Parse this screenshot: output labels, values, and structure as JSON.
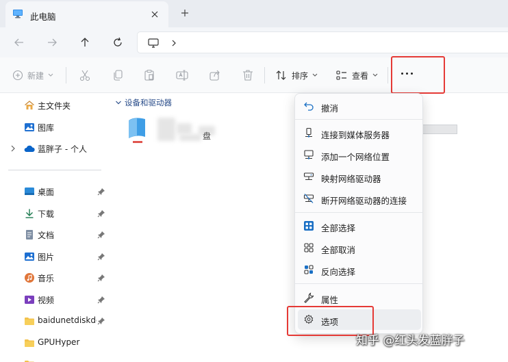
{
  "window": {
    "tab_title": "此电脑"
  },
  "toolbar": {
    "new_label": "新建",
    "sort_label": "排序",
    "view_label": "查看"
  },
  "sidebar": {
    "items": [
      {
        "label": "主文件夹",
        "icon": "home-icon"
      },
      {
        "label": "图库",
        "icon": "gallery-icon"
      },
      {
        "label": "蓝胖子 - 个人",
        "icon": "cloud-icon"
      },
      {
        "label": "桌面",
        "icon": "desktop-icon",
        "pinned": true
      },
      {
        "label": "下载",
        "icon": "download-icon",
        "pinned": true
      },
      {
        "label": "文档",
        "icon": "document-icon",
        "pinned": true
      },
      {
        "label": "图片",
        "icon": "picture-icon",
        "pinned": true
      },
      {
        "label": "音乐",
        "icon": "music-icon",
        "pinned": true
      },
      {
        "label": "视频",
        "icon": "video-icon",
        "pinned": true
      },
      {
        "label": "baidunetdiskdownload",
        "icon": "folder-icon",
        "pinned": true
      },
      {
        "label": "GPUHyper",
        "icon": "folder-icon"
      }
    ]
  },
  "main": {
    "group_title": "设备和驱动器",
    "drive_label_fragment": "盘"
  },
  "context_menu": {
    "items": [
      {
        "label": "撤消",
        "icon": "undo-icon"
      },
      {
        "label": "连接到媒体服务器",
        "icon": "media-server-icon"
      },
      {
        "label": "添加一个网络位置",
        "icon": "network-location-icon"
      },
      {
        "label": "映射网络驱动器",
        "icon": "map-drive-icon"
      },
      {
        "label": "断开网络驱动器的连接",
        "icon": "disconnect-drive-icon"
      },
      {
        "label": "全部选择",
        "icon": "select-all-icon"
      },
      {
        "label": "全部取消",
        "icon": "select-none-icon"
      },
      {
        "label": "反向选择",
        "icon": "invert-selection-icon"
      },
      {
        "label": "属性",
        "icon": "wrench-icon"
      },
      {
        "label": "选项",
        "icon": "gear-icon"
      }
    ]
  },
  "watermark": "知乎 @红头发蓝胖子",
  "colors": {
    "highlight_box": "#e53935",
    "accent": "#0067c0"
  }
}
